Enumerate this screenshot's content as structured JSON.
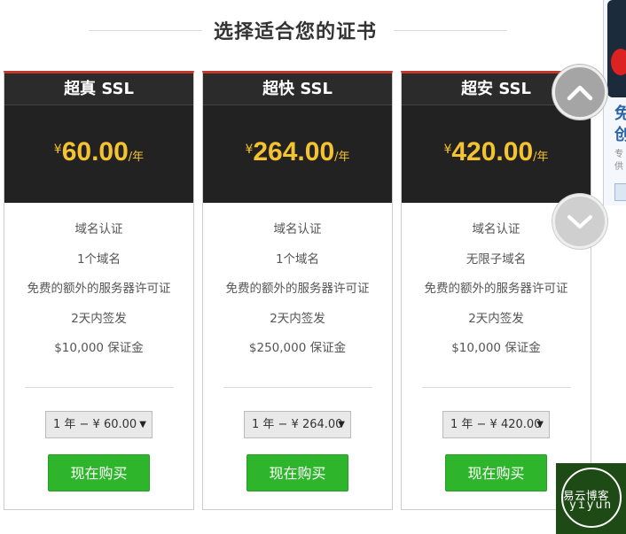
{
  "page": {
    "title": "选择适合您的证书"
  },
  "plans": [
    {
      "name": "超真 SSL",
      "currency": "¥",
      "price": "60.00",
      "unit": "/年",
      "features": [
        "域名认证",
        "1个域名",
        "免费的额外的服务器许可证",
        "2天内签发",
        "$10,000 保证金"
      ],
      "term_select": "1 年 − ¥ 60.00",
      "buy_label": "现在购买"
    },
    {
      "name": "超快 SSL",
      "currency": "¥",
      "price": "264.00",
      "unit": "/年",
      "features": [
        "域名认证",
        "1个域名",
        "免费的额外的服务器许可证",
        "2天内签发",
        "$250,000 保证金"
      ],
      "term_select": "1 年 − ¥ 264.00",
      "buy_label": "现在购买"
    },
    {
      "name": "超安 SSL",
      "currency": "¥",
      "price": "420.00",
      "unit": "/年",
      "features": [
        "域名认证",
        "无限子域名",
        "免费的额外的服务器许可证",
        "2天内签发",
        "$10,000 保证金"
      ],
      "term_select": "1 年 − ¥ 420.00",
      "buy_label": "现在购买"
    }
  ],
  "side_ad": {
    "text_large": "免\n创",
    "text_small": "专\n供"
  },
  "watermark": {
    "line1": "易云博客",
    "line2": "yiyun"
  },
  "icons": {
    "scroll_up": "chevron-up-icon",
    "scroll_down": "chevron-down-icon",
    "select_arrow": "caret-down-icon"
  },
  "colors": {
    "accent_price": "#f5c230",
    "header_bg": "#2b2b2b",
    "buy_button": "#2fb52b",
    "card_top_border": "#c0392b"
  }
}
